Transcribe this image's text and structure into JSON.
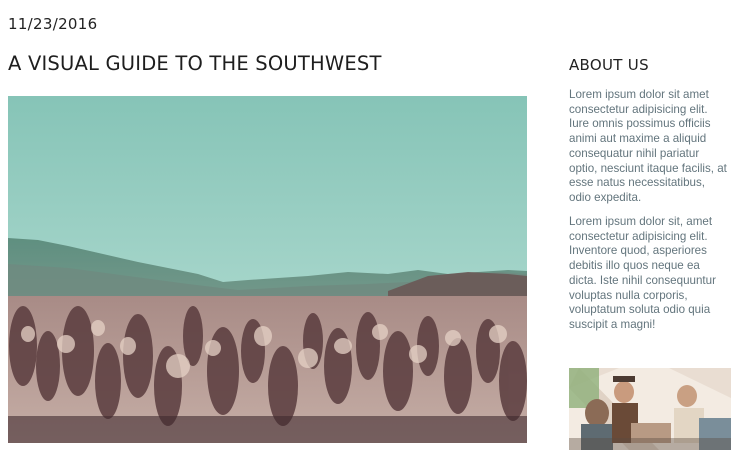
{
  "post": {
    "date": "11/23/2016",
    "title": "A VISUAL GUIDE TO THE SOUTHWEST",
    "hero_image": "desert-cactus-landscape-photo"
  },
  "sidebar": {
    "title": "ABOUT US",
    "paragraph_1": "Lorem ipsum dolor sit amet consectetur adipisicing elit. Iure omnis possimus officiis animi aut maxime a aliquid consequatur nihil pariatur optio, nesciunt itaque facilis, at esse natus necessitatibus, odio expedita.",
    "paragraph_2": "Lorem ipsum dolor sit, amet consectetur adipisicing elit. Inventore quod, asperiores debitis illo quos neque ea dicta. Iste nihil consequuntur voluptas nulla corporis, voluptatum soluta odio quia suscipit a magni!",
    "thumbnail_image": "people-camping-tent-photo"
  }
}
